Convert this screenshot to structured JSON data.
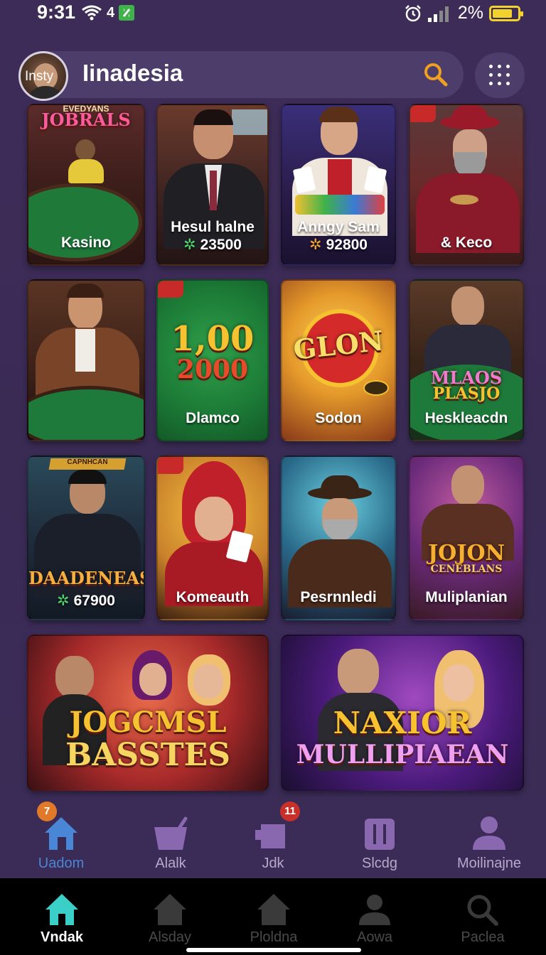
{
  "status_bar": {
    "time": "9:31",
    "net_label": "4",
    "battery_percent": "2%",
    "battery_level": 0.8
  },
  "header": {
    "avatar_text": "Insty",
    "title": "Iinadesia"
  },
  "tiles": [
    {
      "label": "Kasino",
      "logo": "JOBRALS",
      "logo_top": "EVEDYANS"
    },
    {
      "label": "Hesul halne",
      "sub": "23500"
    },
    {
      "label": "Anngy Sam",
      "sub": "92800"
    },
    {
      "label": "& Keco"
    },
    {
      "label": ""
    },
    {
      "label": "Dlamco",
      "big_top": "1,00",
      "big_bottom": "2000"
    },
    {
      "label": "Sodon",
      "logo": "GLON"
    },
    {
      "label": "Heskleacdn",
      "logo_top": "MLAOS",
      "logo_bottom": "PLASJO"
    },
    {
      "label": "",
      "logo": "DAADENEAS",
      "sub": "67900",
      "ribbon": "CAPNHCAN"
    },
    {
      "label": "Komeauth"
    },
    {
      "label": "Pesrnnledi"
    },
    {
      "label": "Muliplanian",
      "logo_top": "JOJON",
      "logo_bottom": "CENEBLANS"
    },
    {
      "label": "",
      "logo_top": "JOGCMSL",
      "logo_bottom": "BASSTES"
    },
    {
      "label": "",
      "logo_top": "NAXIOR",
      "logo_bottom": "MULLIPIAEAN"
    }
  ],
  "nav_top": [
    {
      "label": "Uadom",
      "icon": "home-icon",
      "badge": "7",
      "active": true
    },
    {
      "label": "Alalk",
      "icon": "basket-icon"
    },
    {
      "label": "Jdk",
      "icon": "bag-icon",
      "badge": "11"
    },
    {
      "label": "Slcdg",
      "icon": "columns-icon"
    },
    {
      "label": "Moilinajne",
      "icon": "person-icon"
    }
  ],
  "nav_bottom": [
    {
      "label": "Vndak",
      "icon": "home-icon",
      "active": true
    },
    {
      "label": "Alsday",
      "icon": "home-icon"
    },
    {
      "label": "Ploldna",
      "icon": "home-icon"
    },
    {
      "label": "Aowa",
      "icon": "person-icon"
    },
    {
      "label": "Paclea",
      "icon": "search-icon"
    }
  ],
  "colors": {
    "background": "#3a2b55",
    "accent_active": "#4a86d6",
    "badge_orange": "#e07a2a",
    "badge_red": "#c8302a"
  }
}
